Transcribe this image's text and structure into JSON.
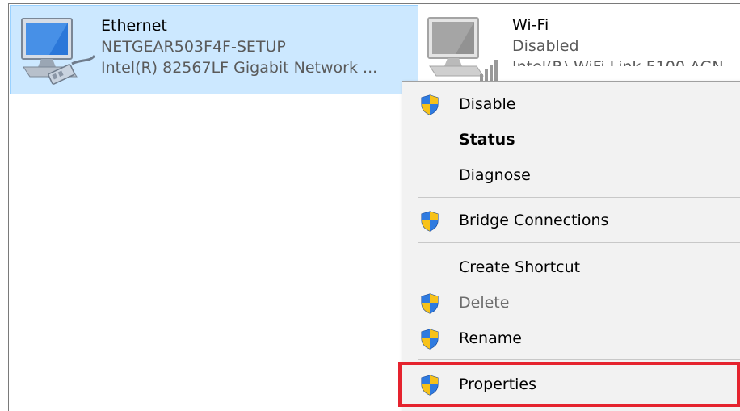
{
  "adapters": {
    "ethernet": {
      "name": "Ethernet",
      "network": "NETGEAR503F4F-SETUP",
      "device": "Intel(R) 82567LF Gigabit Network ...",
      "icon": "ethernet-adapter-icon"
    },
    "wifi": {
      "name": "Wi-Fi",
      "status": "Disabled",
      "device": "Intel(R) WiFi Link 5100 AGN",
      "icon": "wifi-adapter-icon"
    }
  },
  "context_menu": {
    "items": [
      {
        "label": "Disable",
        "shield": true,
        "style": "normal"
      },
      {
        "label": "Status",
        "shield": false,
        "style": "bold"
      },
      {
        "label": "Diagnose",
        "shield": false,
        "style": "normal"
      },
      {
        "label": "Bridge Connections",
        "shield": true,
        "style": "normal"
      },
      {
        "label": "Create Shortcut",
        "shield": false,
        "style": "normal"
      },
      {
        "label": "Delete",
        "shield": true,
        "style": "disabled"
      },
      {
        "label": "Rename",
        "shield": true,
        "style": "normal"
      },
      {
        "label": "Properties",
        "shield": true,
        "style": "normal"
      }
    ]
  },
  "colors": {
    "selection_bg": "#cce8ff",
    "highlight_border": "#e5232e",
    "shield_blue": "#1f5fbf",
    "shield_yellow": "#f7c21a"
  }
}
